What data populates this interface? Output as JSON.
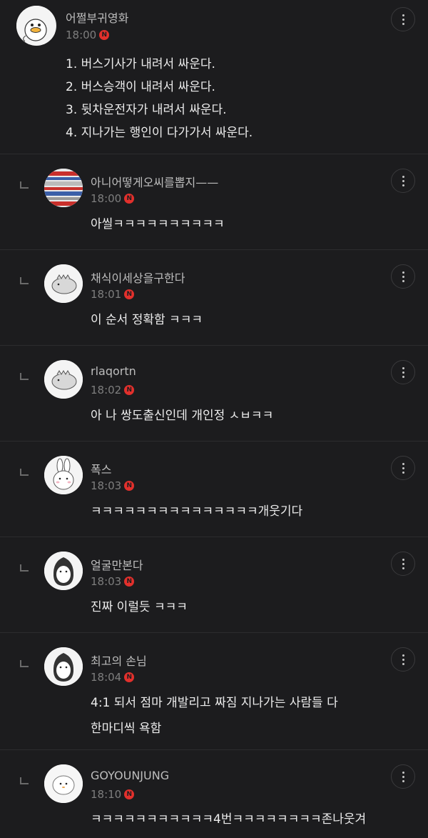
{
  "comments": [
    {
      "nickname": "어쩔부귀영화",
      "time": "18:00",
      "badge": "N",
      "text": "1. 버스기사가 내려서 싸운다.\n2. 버스승객이 내려서 싸운다.\n3. 뒷차운전자가 내려서 싸운다.\n4. 지나가는 행인이 다가가서 싸운다.",
      "avatar_icon": "duck-avatar-icon"
    },
    {
      "nickname": "아니어떻게오씨를뽑지——",
      "time": "18:00",
      "badge": "N",
      "text": "아씰ㅋㅋㅋㅋㅋㅋㅋㅋㅋㅋ",
      "avatar_icon": "striped-avatar-icon"
    },
    {
      "nickname": "채식이세상을구한다",
      "time": "18:01",
      "badge": "N",
      "text": "이 순서 정확함 ㅋㅋㅋ",
      "avatar_icon": "dinosaur-avatar-icon"
    },
    {
      "nickname": "rlaqortn",
      "time": "18:02",
      "badge": "N",
      "text": "아 나 쌍도출신인데 개인정 ㅅㅂㅋㅋ",
      "avatar_icon": "dinosaur-avatar-icon"
    },
    {
      "nickname": "폭스",
      "time": "18:03",
      "badge": "N",
      "text": "ㅋㅋㅋㅋㅋㅋㅋㅋㅋㅋㅋㅋㅋㅋㅋ개웃기다",
      "avatar_icon": "rabbit-avatar-icon"
    },
    {
      "nickname": "얼굴만본다",
      "time": "18:03",
      "badge": "N",
      "text": "진짜 이럴듯 ㅋㅋㅋ",
      "avatar_icon": "penguin-avatar-icon"
    },
    {
      "nickname": "최고의 손님",
      "time": "18:04",
      "badge": "N",
      "text": "4:1 되서 점마 개발리고 짜짐 지나가는 사람들 다\n한마디씩 욕함",
      "avatar_icon": "penguin-avatar-icon"
    },
    {
      "nickname": "GOYOUNJUNG",
      "time": "18:10",
      "badge": "N",
      "text": "ㅋㅋㅋㅋㅋㅋㅋㅋㅋㅋㅋ4번ㅋㅋㅋㅋㅋㅋㅋㅋ존나웃겨",
      "avatar_icon": "blob-avatar-icon"
    }
  ],
  "icons": {
    "more": "more-options-icon",
    "reply": "reply-arrow-icon"
  },
  "colors": {
    "background": "#1c1c1e",
    "badge": "#e2302c"
  }
}
